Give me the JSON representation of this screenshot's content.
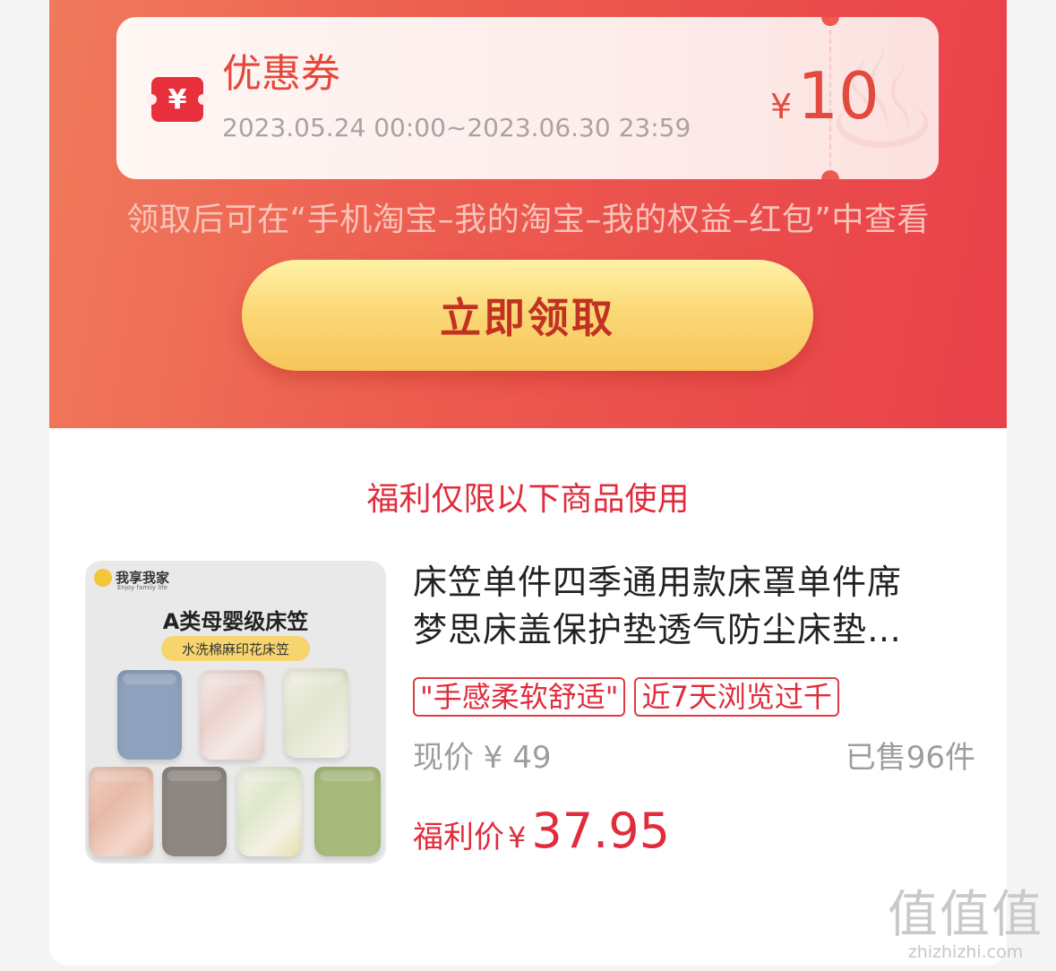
{
  "coupon": {
    "icon": "yen-ticket-icon",
    "icon_glyph": "¥",
    "title": "优惠券",
    "validity": "2023.05.24 00:00~2023.06.30 23:59",
    "currency": "¥",
    "amount": "10"
  },
  "hint": "领取后可在“手机淘宝–我的淘宝–我的权益–红包”中查看",
  "claim_button_label": "立即领取",
  "section_title": "福利仅限以下商品使用",
  "product": {
    "image_logo_text": "我享我家",
    "image_logo_sub": "Enjoy family life",
    "image_headline": "A类母婴级床笠",
    "image_tag": "水洗棉麻印花床笠",
    "title_line1": "床笠单件四季通用款床罩单件席",
    "title_line2": "梦思床盖保护垫透气防尘床垫…",
    "tags": [
      "\"手感柔软舒适\"",
      "近7天浏览过千"
    ],
    "current_price_label": "现价 ¥ 49",
    "sold_label": "已售96件",
    "welfare_label": "福利价",
    "welfare_currency": "¥",
    "welfare_price": "37.95"
  },
  "watermark": {
    "big": "值值值",
    "small": "zhizhizhi.com"
  },
  "colors": {
    "accent_red": "#e02c3c",
    "coupon_red": "#e24a3d",
    "button_gold": "#f6c45a"
  }
}
